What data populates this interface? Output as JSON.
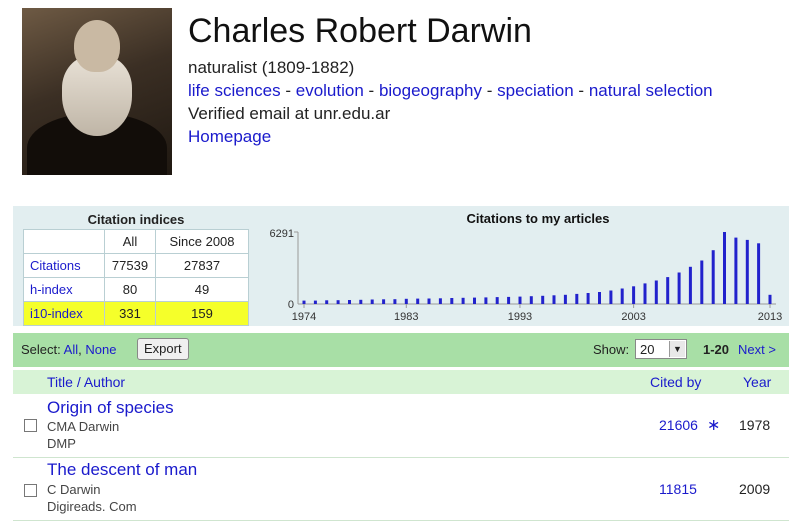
{
  "profile": {
    "name": "Charles Robert Darwin",
    "affiliation": "naturalist (1809-1882)",
    "interests": [
      "life sciences",
      "evolution",
      "biogeography",
      "speciation",
      "natural selection"
    ],
    "interest_separator": "-",
    "email": "Verified email at unr.edu.ar",
    "homepage": "Homepage",
    "photo_icon": "author-photo"
  },
  "indices": {
    "caption": "Citation indices",
    "columns": [
      "All",
      "Since 2008"
    ],
    "rows": [
      {
        "label": "Citations",
        "all": "77539",
        "since": "27837"
      },
      {
        "label": "h-index",
        "all": "80",
        "since": "49"
      },
      {
        "label": "i10-index",
        "all": "331",
        "since": "159"
      }
    ],
    "highlight_color": "#f5ff2a"
  },
  "chart_data": {
    "type": "bar",
    "title": "Citations to my articles",
    "ymax_label": "6291",
    "ymin_label": "0",
    "ylim": [
      0,
      6291
    ],
    "x_tick_labels": [
      "1974",
      "1983",
      "1993",
      "2003",
      "2013"
    ],
    "categories": [
      "1974",
      "1975",
      "1976",
      "1977",
      "1978",
      "1979",
      "1980",
      "1981",
      "1982",
      "1983",
      "1984",
      "1985",
      "1986",
      "1987",
      "1988",
      "1989",
      "1990",
      "1991",
      "1992",
      "1993",
      "1994",
      "1995",
      "1996",
      "1997",
      "1998",
      "1999",
      "2000",
      "2001",
      "2002",
      "2003",
      "2004",
      "2005",
      "2006",
      "2007",
      "2008",
      "2009",
      "2010",
      "2011",
      "2012",
      "2013"
    ],
    "values": [
      300,
      300,
      320,
      330,
      350,
      370,
      390,
      410,
      420,
      450,
      470,
      480,
      500,
      520,
      540,
      560,
      580,
      600,
      620,
      650,
      680,
      720,
      760,
      800,
      880,
      960,
      1050,
      1180,
      1350,
      1550,
      1800,
      2050,
      2350,
      2750,
      3250,
      3800,
      4700,
      6291,
      5800,
      5600,
      5300,
      800
    ],
    "bar_color": "#2222cc",
    "grid": false
  },
  "toolbar": {
    "select_label": "Select:",
    "all": "All",
    "comma": ",",
    "none": "None",
    "export": "Export",
    "show_label": "Show:",
    "show_value": "20",
    "range": "1-20",
    "next": "Next >"
  },
  "table": {
    "col_title": "Title / Author",
    "col_cited": "Cited by",
    "col_year": "Year",
    "articles": [
      {
        "title": "Origin of species",
        "author": "CMA Darwin",
        "venue": "DMP",
        "cited": "21606",
        "star": "∗",
        "year": "1978"
      },
      {
        "title": "The descent of man",
        "author": "C Darwin",
        "venue": "Digireads. Com",
        "cited": "11815",
        "year": "2009"
      }
    ]
  }
}
